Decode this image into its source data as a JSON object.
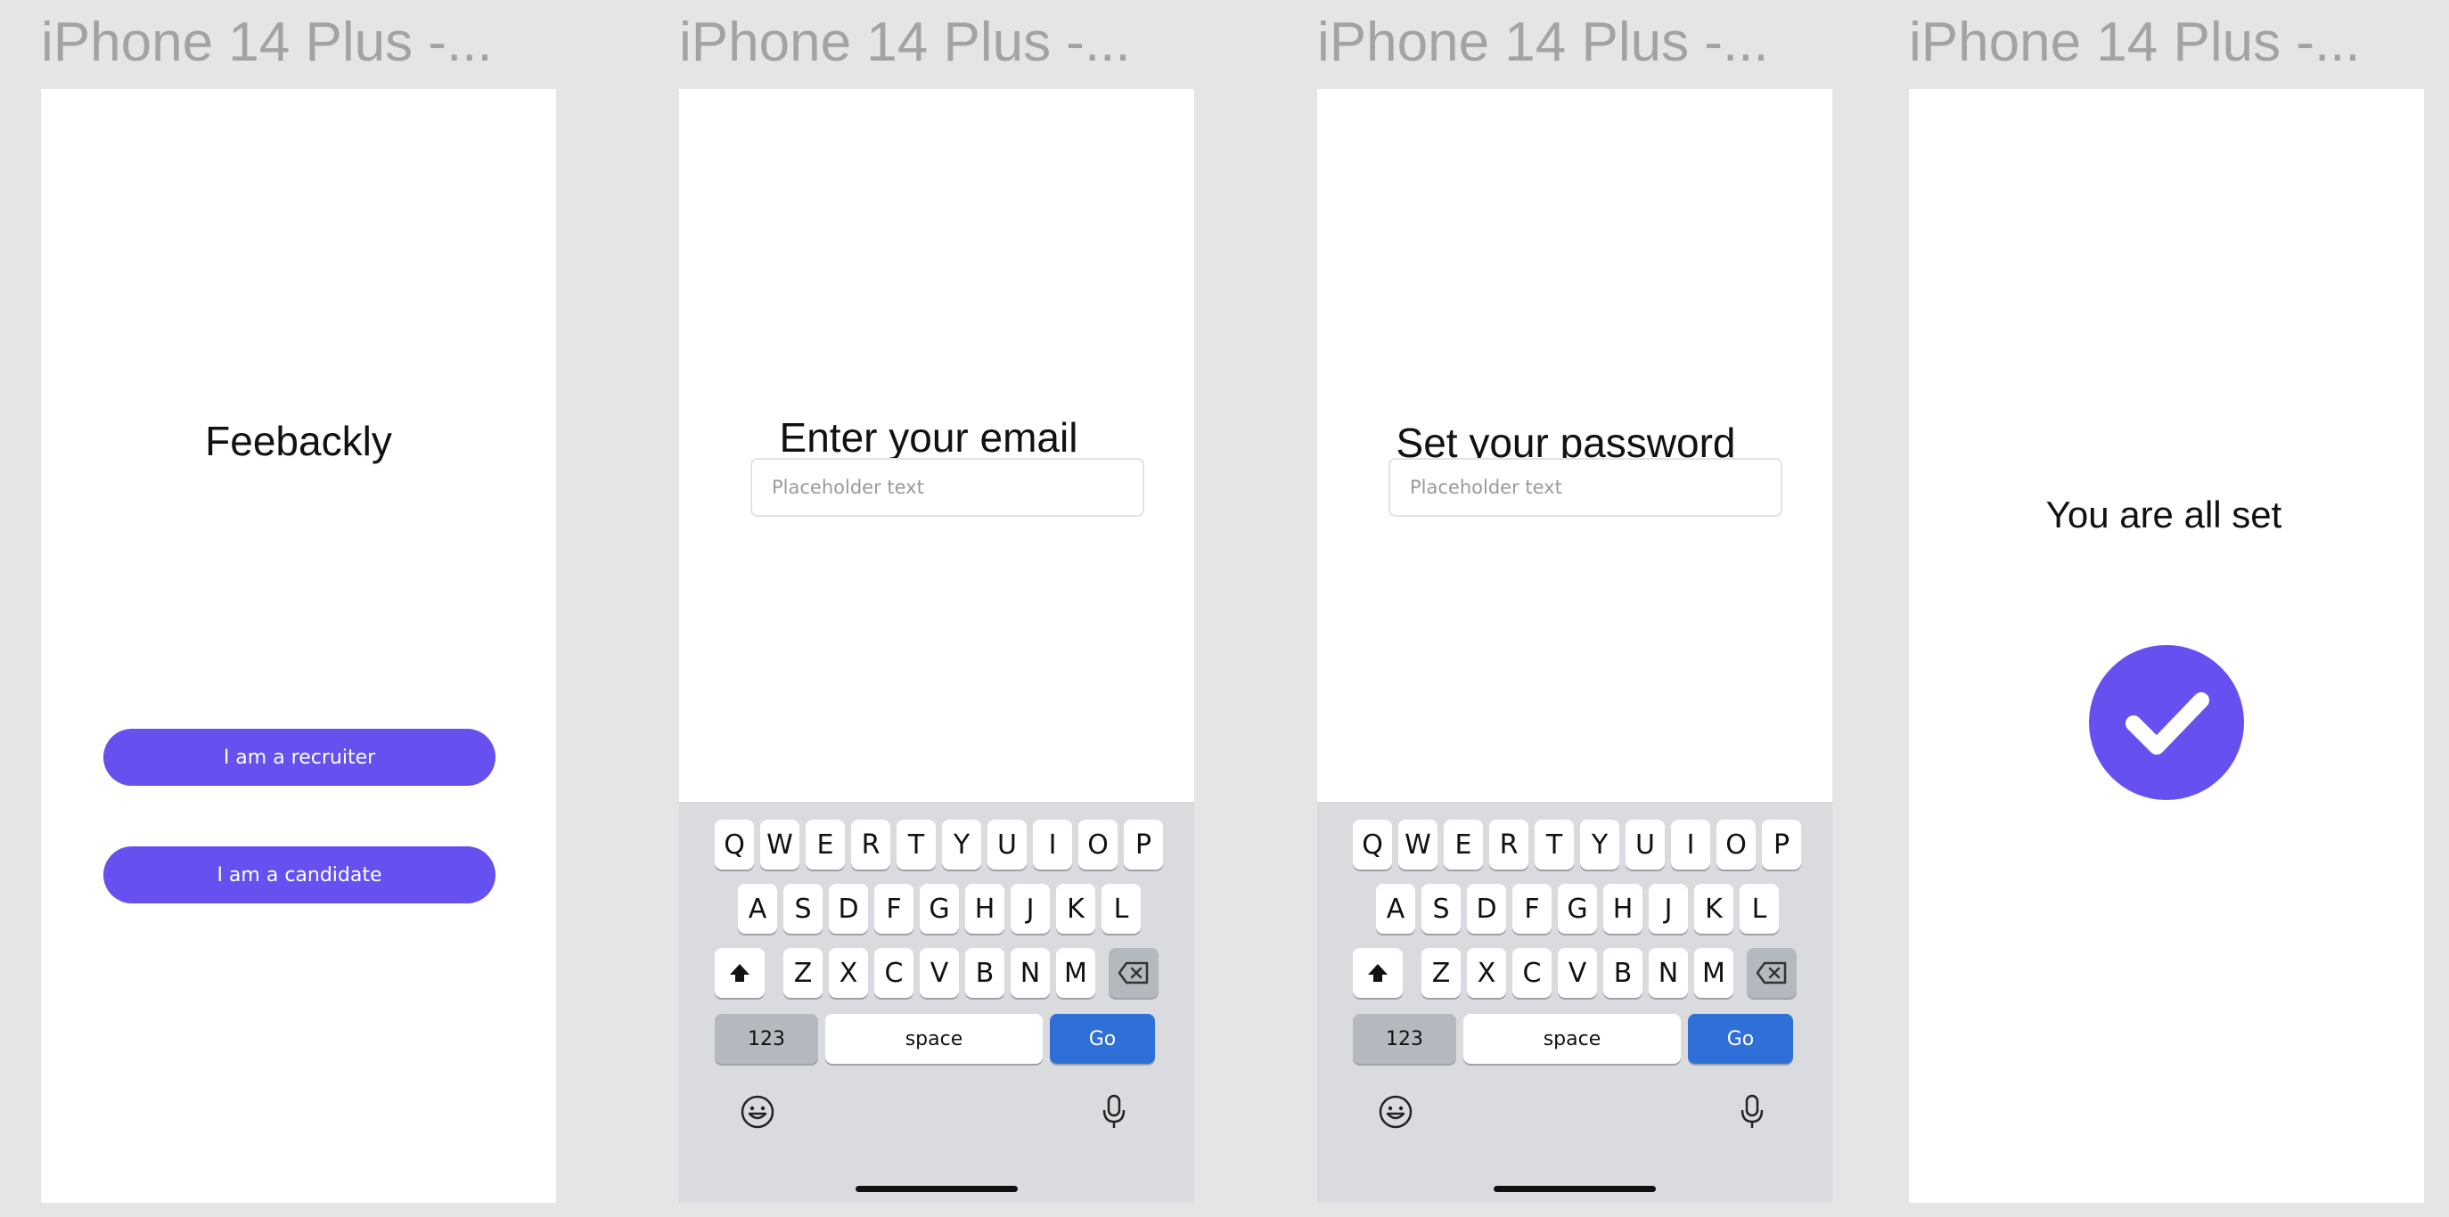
{
  "frames": [
    {
      "label": "iPhone 14 Plus -...",
      "title": "Feebackly",
      "buttons": [
        "I am a recruiter",
        "I am a candidate"
      ]
    },
    {
      "label": "iPhone 14 Plus -...",
      "title": "Enter your email",
      "input_placeholder": "Placeholder text"
    },
    {
      "label": "iPhone 14 Plus -...",
      "title": "Set your password",
      "input_placeholder": "Placeholder text"
    },
    {
      "label": "iPhone 14 Plus -...",
      "title": "You are all set",
      "icon": "checkmark-circle-icon"
    }
  ],
  "keyboard": {
    "row1": [
      "Q",
      "W",
      "E",
      "R",
      "T",
      "Y",
      "U",
      "I",
      "O",
      "P"
    ],
    "row2": [
      "A",
      "S",
      "D",
      "F",
      "G",
      "H",
      "J",
      "K",
      "L"
    ],
    "row3": [
      "Z",
      "X",
      "C",
      "V",
      "B",
      "N",
      "M"
    ],
    "numbers_label": "123",
    "space_label": "space",
    "go_label": "Go",
    "icons": [
      "shift-icon",
      "backspace-icon",
      "emoji-icon",
      "microphone-icon"
    ]
  },
  "colors": {
    "accent": "#6650f0",
    "go_key": "#2f6fd8",
    "canvas": "#e5e5e5",
    "label": "#a3a3a3"
  }
}
